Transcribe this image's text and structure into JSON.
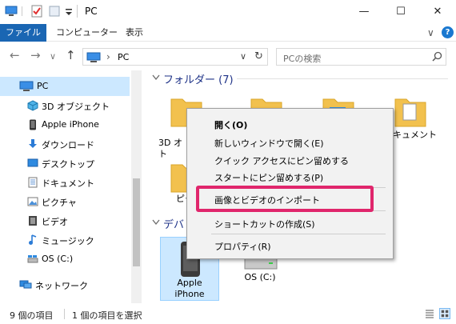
{
  "window": {
    "title": "PC",
    "minimize": "—",
    "maximize": "☐",
    "close": "✕"
  },
  "ribbon": {
    "tabs": [
      "ファイル",
      "コンピューター",
      "表示"
    ],
    "expand": "∨",
    "help": "?"
  },
  "nav": {
    "back": "←",
    "forward": "→",
    "recent": "∨",
    "up": "↑",
    "address_sep": "›",
    "address": "PC",
    "address_dropdown": "∨",
    "refresh": "↻",
    "search_placeholder": "PCの検索"
  },
  "sidebar": {
    "items": [
      {
        "label": "PC",
        "icon": "pc-icon"
      },
      {
        "label": "3D オブジェクト",
        "icon": "3d-objects-icon"
      },
      {
        "label": "Apple iPhone",
        "icon": "iphone-icon"
      },
      {
        "label": "ダウンロード",
        "icon": "download-icon"
      },
      {
        "label": "デスクトップ",
        "icon": "desktop-icon"
      },
      {
        "label": "ドキュメント",
        "icon": "document-icon"
      },
      {
        "label": "ピクチャ",
        "icon": "pictures-icon"
      },
      {
        "label": "ビデオ",
        "icon": "video-icon"
      },
      {
        "label": "ミュージック",
        "icon": "music-icon"
      },
      {
        "label": "OS (C:)",
        "icon": "drive-icon"
      },
      {
        "label": "ネットワーク",
        "icon": "network-icon"
      }
    ]
  },
  "content": {
    "folders_header": "フォルダー (7)",
    "devices_header": "デバ",
    "folder_tiles": [
      {
        "label": "3D オ\nト"
      },
      {
        "label": "ドキュメント"
      },
      {
        "label": "ピク"
      }
    ],
    "devices": [
      {
        "label": "Apple\niPhone"
      },
      {
        "label": "OS (C:)"
      }
    ]
  },
  "context_menu": {
    "items": [
      {
        "label": "開く(O)",
        "bold": true
      },
      {
        "label": "新しいウィンドウで開く(E)"
      },
      {
        "label": "クイック アクセスにピン留めする"
      },
      {
        "label": "スタートにピン留めする(P)"
      },
      {
        "label": "画像とビデオのインポート"
      },
      {
        "label": "ショートカットの作成(S)"
      },
      {
        "label": "プロパティ(R)"
      }
    ]
  },
  "status": {
    "items_count": "9 個の項目",
    "selected": "1 個の項目を選択"
  },
  "colors": {
    "accent": "#1a66b3",
    "selection": "#cce8ff",
    "highlight_box": "#e0266c",
    "folder": "#f2c14e"
  }
}
